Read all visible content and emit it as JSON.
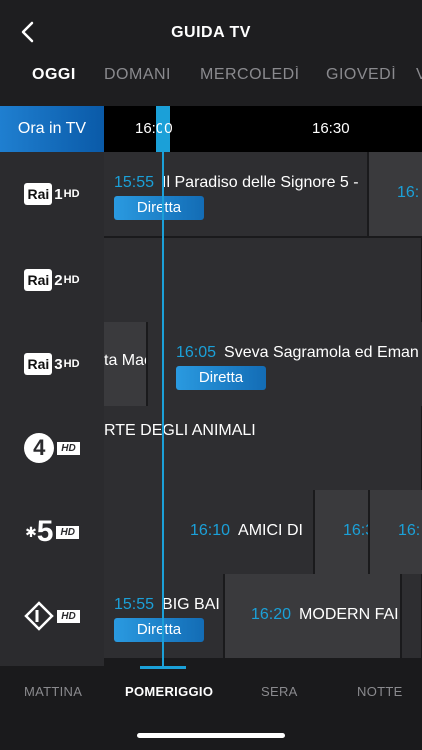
{
  "header": {
    "title": "GUIDA TV",
    "back_icon": "chevron-left-icon"
  },
  "day_tabs": [
    {
      "label": "OGGI",
      "active": true
    },
    {
      "label": "DOMANI",
      "active": false
    },
    {
      "label": "MERCOLEDÌ",
      "active": false
    },
    {
      "label": "GIOVEDÌ",
      "active": false
    },
    {
      "label": "V",
      "active": false
    }
  ],
  "timebar": {
    "ora_label": "Ora in TV",
    "times": [
      "16:00",
      "16:30"
    ]
  },
  "channels": [
    {
      "name": "Rai 1 HD",
      "box": "Rai",
      "num": "1",
      "hd": "HD"
    },
    {
      "name": "Rai 2 HD",
      "box": "Rai",
      "num": "2",
      "hd": "HD"
    },
    {
      "name": "Rai 3 HD",
      "box": "Rai",
      "num": "3",
      "hd": "HD"
    },
    {
      "name": "Rete 4 HD",
      "num": "4",
      "hd": "HD"
    },
    {
      "name": "Canale 5 HD",
      "num": "5",
      "hd": "HD"
    },
    {
      "name": "Italia 1 HD",
      "hd": "HD"
    }
  ],
  "programs": {
    "rai1": [
      {
        "time": "15:55",
        "title": "Il Paradiso delle Signore 5 -",
        "badge": "Diretta"
      },
      {
        "time": "16:",
        "title": ""
      }
    ],
    "rai3": [
      {
        "time": "",
        "title": "ta Mae"
      },
      {
        "time": "16:05",
        "title": "Sveva Sagramola ed Eman",
        "badge": "Diretta"
      }
    ],
    "rete4": [
      {
        "time": "",
        "title": "RTE DEGLI ANIMALI"
      }
    ],
    "canale5": [
      {
        "time": "16:10",
        "title": "AMICI DI"
      },
      {
        "time": "16:3",
        "title": ""
      },
      {
        "time": "16:",
        "title": ""
      }
    ],
    "italia1": [
      {
        "time": "15:55",
        "title": "BIG BAI",
        "badge": "Diretta"
      },
      {
        "time": "16:20",
        "title": "MODERN FAI"
      }
    ]
  },
  "bottom_tabs": [
    {
      "label": "MATTINA",
      "active": false
    },
    {
      "label": "POMERIGGIO",
      "active": true
    },
    {
      "label": "SERA",
      "active": false
    },
    {
      "label": "NOTTE",
      "active": false
    }
  ],
  "colors": {
    "accent": "#1ba0d8",
    "background": "#1a1a1c",
    "cell": "#2e2e31",
    "badge": "#2a9ae0"
  }
}
